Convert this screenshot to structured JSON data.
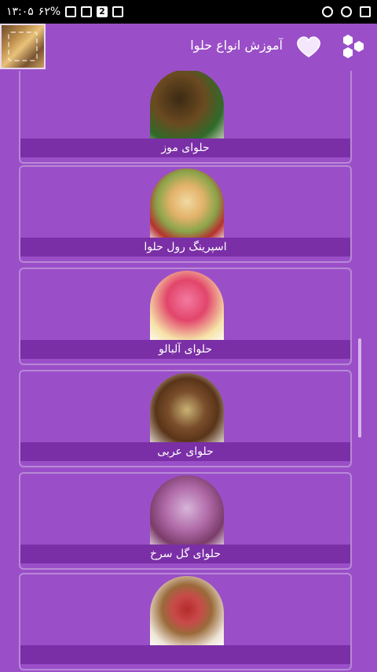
{
  "status_bar": {
    "time": "۱۳:۰۵",
    "battery_percent": "۶۲%",
    "notification_count": "2"
  },
  "app_bar": {
    "title": "آموزش انواع حلوا"
  },
  "list": {
    "items": [
      {
        "label": "حلوای موز"
      },
      {
        "label": "اسپرینگ رول حلوا"
      },
      {
        "label": "حلوای آلبالو"
      },
      {
        "label": "حلوای عربی"
      },
      {
        "label": "حلوای گل سرخ"
      },
      {
        "label": ""
      }
    ]
  },
  "colors": {
    "background": "#9a4fc8",
    "label_bar": "#7b2fa6",
    "card_border": "#b889d6"
  },
  "icons": [
    "wifi-icon",
    "battery-icon",
    "photo-icon",
    "alarm-icon",
    "heart-icon",
    "hexagon-menu-icon"
  ]
}
